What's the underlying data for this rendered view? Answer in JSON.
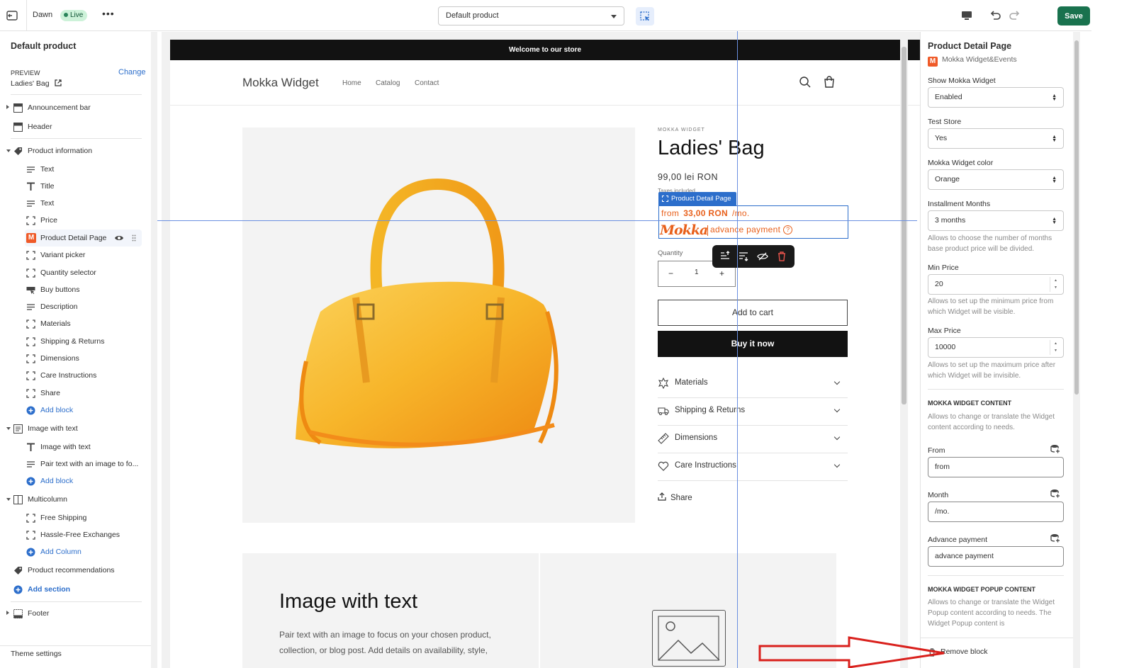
{
  "topbar": {
    "theme_name": "Dawn",
    "status_badge": "Live",
    "more_label": "•••",
    "template_select": "Default product",
    "save_label": "Save"
  },
  "left": {
    "header": "Default product",
    "preview_label": "PREVIEW",
    "change_label": "Change",
    "preview_value": "Ladies' Bag",
    "items": {
      "announcement_bar": "Announcement bar",
      "header": "Header",
      "product_information": "Product information",
      "text1": "Text",
      "title": "Title",
      "text2": "Text",
      "price": "Price",
      "product_detail_page": "Product Detail Page",
      "variant_picker": "Variant picker",
      "quantity_selector": "Quantity selector",
      "buy_buttons": "Buy buttons",
      "description": "Description",
      "materials": "Materials",
      "shipping_returns": "Shipping & Returns",
      "dimensions": "Dimensions",
      "care_instructions": "Care Instructions",
      "share": "Share",
      "add_block1": "Add block",
      "image_with_text": "Image with text",
      "image_with_text_heading": "Image with text",
      "pair_text": "Pair text with an image to fo...",
      "add_block2": "Add block",
      "multicolumn": "Multicolumn",
      "free_shipping": "Free Shipping",
      "hassle_free": "Hassle-Free Exchanges",
      "add_column": "Add Column",
      "product_recommendations": "Product recommendations",
      "add_section": "Add section",
      "footer": "Footer"
    },
    "theme_settings": "Theme settings"
  },
  "store": {
    "announcement": "Welcome to our store",
    "logo": "Mokka Widget",
    "nav": [
      "Home",
      "Catalog",
      "Contact"
    ],
    "vendor": "MOKKA WIDGET",
    "title": "Ladies' Bag",
    "price": "99,00 lei RON",
    "taxes": "Taxes included.",
    "block_tag": "Product Detail Page",
    "widget": {
      "from": "from",
      "amount": "33,00 RON",
      "per_month": "/mo.",
      "logo": "Mokka",
      "advance": "advance payment",
      "help": "?"
    },
    "quantity_label": "Quantity",
    "quantity_value": "1",
    "minus": "−",
    "plus": "+",
    "add_to_cart": "Add to cart",
    "buy_now": "Buy it now",
    "accordions": [
      "Materials",
      "Shipping & Returns",
      "Dimensions",
      "Care Instructions"
    ],
    "share": "Share",
    "iwt_title": "Image with text",
    "iwt_text": "Pair text with an image to focus on your chosen product, collection, or blog post. Add details on availability, style,"
  },
  "right": {
    "title": "Product Detail Page",
    "app_icon": "M",
    "app_name": "Mokka Widget&Events",
    "show_widget_label": "Show Mokka Widget",
    "show_widget_value": "Enabled",
    "test_store_label": "Test Store",
    "test_store_value": "Yes",
    "color_label": "Mokka Widget color",
    "color_value": "Orange",
    "months_label": "Installment Months",
    "months_value": "3 months",
    "months_help": "Allows to choose the number of months base product price will be divided.",
    "min_label": "Min Price",
    "min_value": "20",
    "min_help": "Allows to set up the minimum price from which Widget will be visible.",
    "max_label": "Max Price",
    "max_value": "10000",
    "max_help": "Allows to set up the maximum price after which Widget will be invisible.",
    "content_header": "MOKKA WIDGET CONTENT",
    "content_help": "Allows to change or translate the Widget content according to needs.",
    "from_label": "From",
    "from_value": "from",
    "month_label": "Month",
    "month_value": "/mo.",
    "advance_label": "Advance payment",
    "advance_value": "advance payment",
    "popup_header": "MOKKA WIDGET POPUP CONTENT",
    "popup_help": "Allows to change or translate the Widget Popup content according to needs. The Widget Popup content is",
    "remove_block": "Remove block"
  },
  "colors": {
    "accent_blue": "#2c6ecb",
    "save_green": "#19724e",
    "mokka_orange": "#e8601b",
    "annotation_red": "#d9201c"
  }
}
